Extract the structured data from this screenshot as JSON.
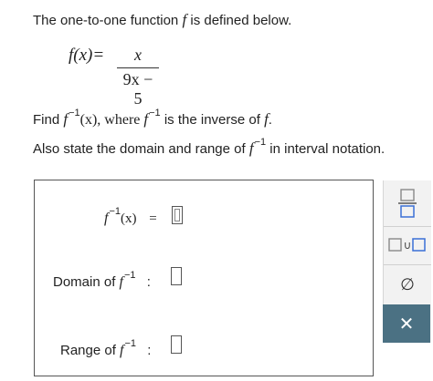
{
  "question": {
    "line1_pre": "The one-to-one function ",
    "line1_f": "f",
    "line1_post": " is defined below.",
    "formula_lhs": "f(x)=",
    "formula_num": "x",
    "formula_den": "9x − 5",
    "line3_pre": "Find ",
    "line3_f": "f",
    "line3_sup": "−1",
    "line3_mid": "(x), where ",
    "line3_f2": "f",
    "line3_sup2": "−1",
    "line3_post": " is the inverse of ",
    "line3_f3": "f",
    "line3_end": ".",
    "line4_pre": "Also state the domain and range of ",
    "line4_f": "f",
    "line4_sup": "−1",
    "line4_post": " in interval notation."
  },
  "answer": {
    "inverse_f": "f",
    "inverse_sup": "−1",
    "inverse_arg": "(x)",
    "equals": "=",
    "domain_label": "Domain of ",
    "domain_f": "f",
    "domain_sup": "−1",
    "domain_colon": ":",
    "range_label": "Range of ",
    "range_f": "f",
    "range_sup": "−1",
    "range_colon": ":"
  },
  "toolbar": {
    "union_symbol": "∪",
    "empty_set_symbol": "∅",
    "close_symbol": "✕"
  },
  "colors": {
    "accent": "#4b7183",
    "toolbar_bg": "#f2f2f2",
    "icon_blue": "#3b6fd6"
  }
}
